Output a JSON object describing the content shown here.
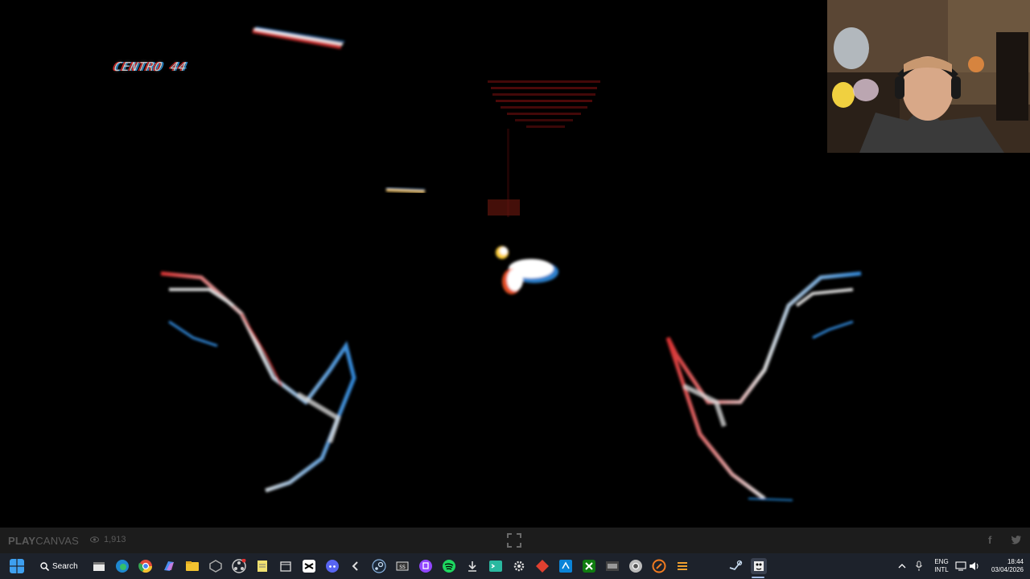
{
  "game": {
    "hud_text": "CENTRO 44"
  },
  "playcanvas_bar": {
    "logo_play": "PLAY",
    "logo_canvas": "CANVAS",
    "view_count": "1,913",
    "fullscreen_icon": "fullscreen-icon",
    "facebook_icon": "f",
    "twitter_icon": "twitter-icon"
  },
  "taskbar": {
    "search_label": "Search",
    "language_line1": "ENG",
    "language_line2": "INTL",
    "time": "18:44",
    "date": "03/04/2026",
    "app_icons": [
      "file-explorer-icon",
      "edge-icon",
      "chrome-icon",
      "copilot-icon",
      "folder-icon",
      "app-icon",
      "obs-icon",
      "notepad-icon",
      "calendar-icon",
      "capcut-icon",
      "discord-icon",
      "back-icon",
      "steam-icon",
      "app-icon",
      "twitch-icon",
      "spotify-icon",
      "download-icon",
      "terminal-icon",
      "settings-icon",
      "app-icon",
      "vscode-icon",
      "xbox-icon",
      "media-icon",
      "chrome-icon",
      "app-icon",
      "app-icon",
      "steam-icon",
      "game-icon"
    ]
  },
  "colors": {
    "taskbar_bg": "#1d222b",
    "playcanvas_bar_bg": "#1c1c1c",
    "game_bg": "#000000"
  }
}
